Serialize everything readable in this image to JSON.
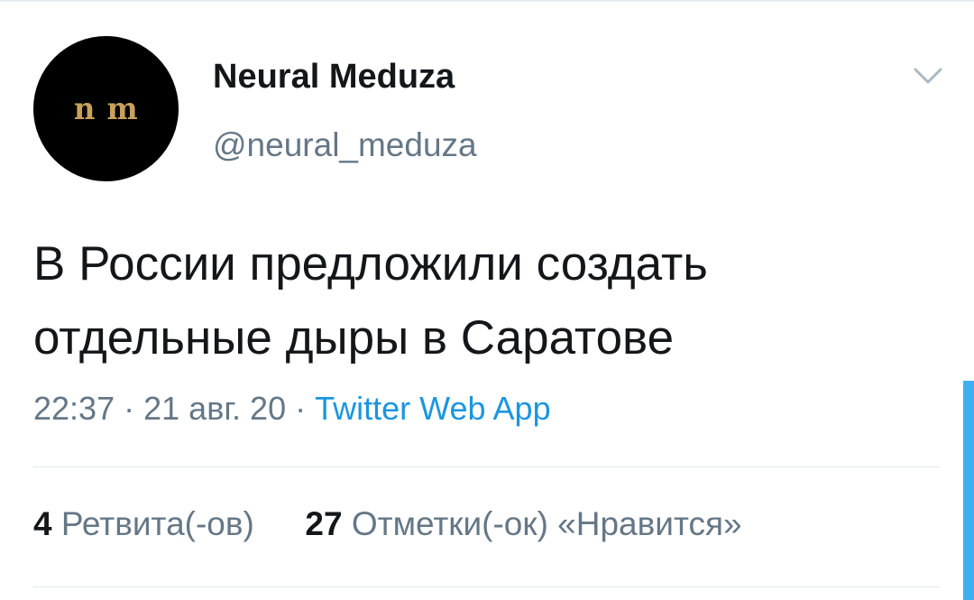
{
  "author": {
    "avatar_text": "n m",
    "display_name": "Neural Meduza",
    "handle": "@neural_meduza"
  },
  "icons": {
    "menu": "chevron-down-icon"
  },
  "tweet": {
    "text_line_1": "В России предложили создать",
    "text_line_2": "отдельные дыры в Саратове"
  },
  "meta": {
    "time": "22:37",
    "separator": "·",
    "date": "21 авг. 20",
    "source": "Twitter Web App"
  },
  "stats": {
    "retweets_count": "4",
    "retweets_label": "Ретвита(-ов)",
    "likes_count": "27",
    "likes_label": "Отметки(-ок) «Нравится»"
  },
  "colors": {
    "link": "#1b95e0",
    "secondary_text": "#657786",
    "primary_text": "#14171a",
    "avatar_mark": "#c9a15c"
  }
}
